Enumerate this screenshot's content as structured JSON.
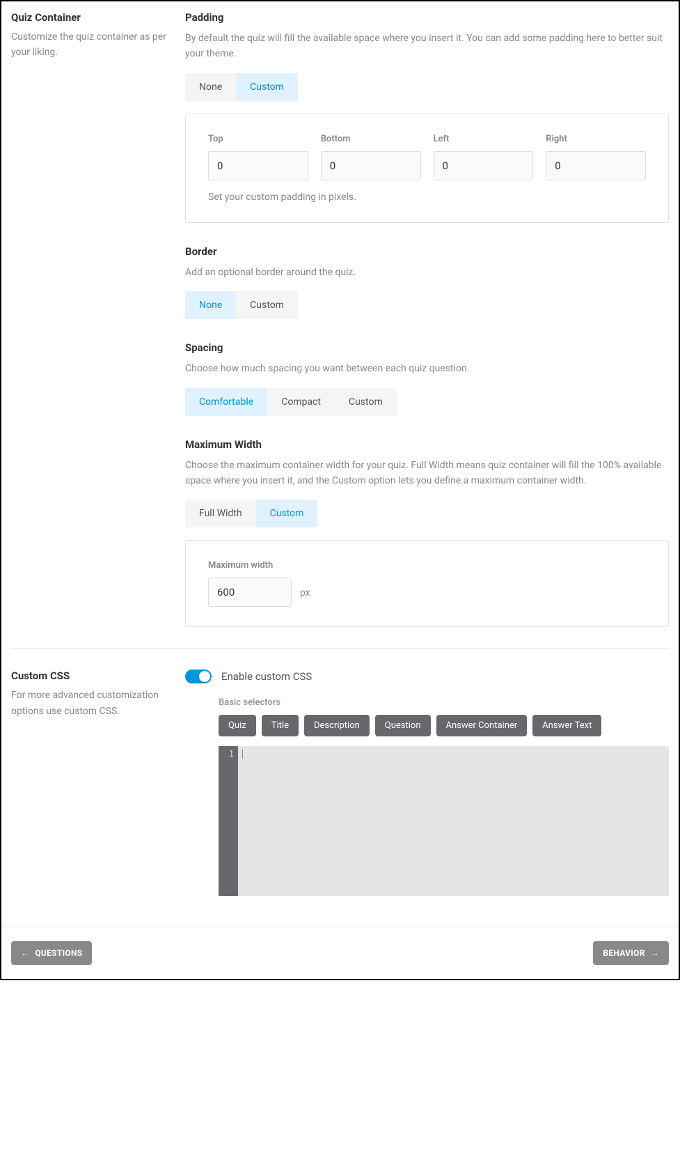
{
  "quiz_container": {
    "title": "Quiz Container",
    "desc": "Customize the quiz container as per your liking."
  },
  "padding": {
    "title": "Padding",
    "desc": "By default the quiz will fill the available space where you insert it. You can add some padding here to better suit your theme.",
    "tabs": {
      "none": "None",
      "custom": "Custom"
    },
    "labels": {
      "top": "Top",
      "bottom": "Bottom",
      "left": "Left",
      "right": "Right"
    },
    "values": {
      "top": "0",
      "bottom": "0",
      "left": "0",
      "right": "0"
    },
    "hint": "Set your custom padding in pixels."
  },
  "border": {
    "title": "Border",
    "desc": "Add an optional border around the quiz.",
    "tabs": {
      "none": "None",
      "custom": "Custom"
    }
  },
  "spacing": {
    "title": "Spacing",
    "desc": "Choose how much spacing you want between each quiz question.",
    "tabs": {
      "comfortable": "Comfortable",
      "compact": "Compact",
      "custom": "Custom"
    }
  },
  "maxwidth": {
    "title": "Maximum Width",
    "desc": "Choose the maximum container width for your quiz. Full Width means quiz container will fill the 100% available space where you insert it, and the Custom option lets you define a maximum container width.",
    "tabs": {
      "full": "Full Width",
      "custom": "Custom"
    },
    "panel_label": "Maximum width",
    "value": "600",
    "unit": "px"
  },
  "custom_css": {
    "title": "Custom CSS",
    "desc": "For more advanced customization options use custom CSS.",
    "toggle_label": "Enable custom CSS",
    "basic_label": "Basic selectors",
    "selectors": [
      "Quiz",
      "Title",
      "Description",
      "Question",
      "Answer Container",
      "Answer Text"
    ],
    "line_num": "1"
  },
  "footer": {
    "prev": "QUESTIONS",
    "next": "BEHAVIOR"
  }
}
